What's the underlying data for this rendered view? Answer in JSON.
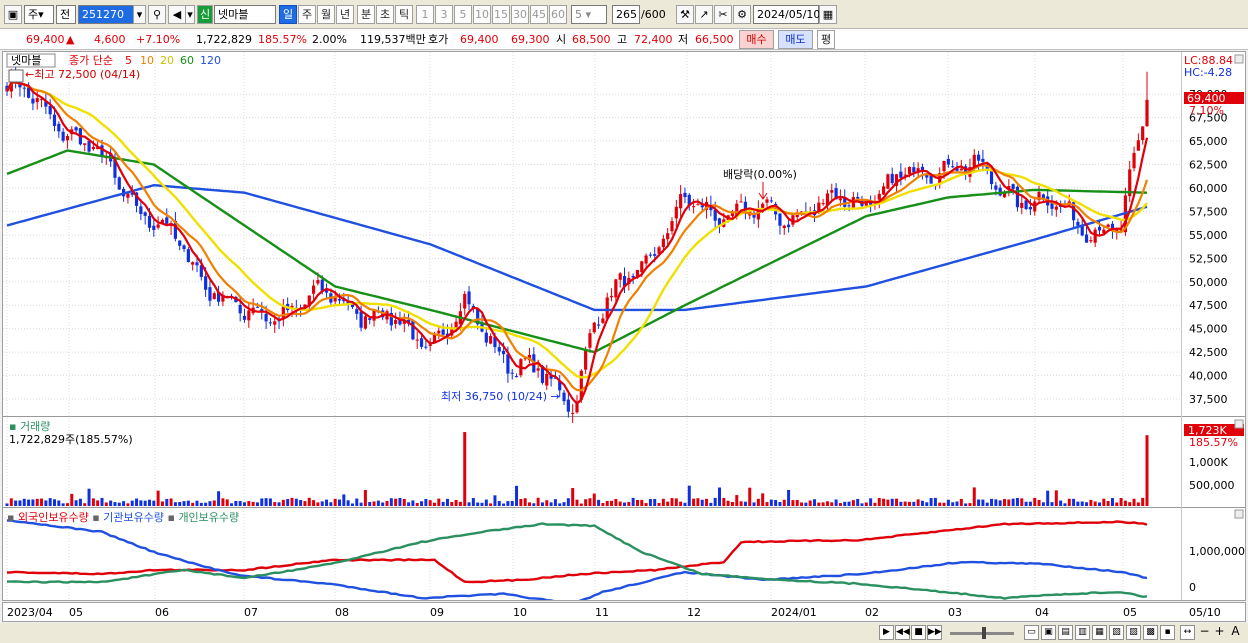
{
  "toolbar": {
    "market": "주",
    "prev": "전",
    "code": "251270",
    "shin": "신",
    "stock_name": "넷마블",
    "periods": [
      "일",
      "주",
      "월",
      "년",
      "분",
      "초",
      "틱"
    ],
    "active_period": "일",
    "nums": [
      "1",
      "3",
      "5",
      "10",
      "15",
      "30",
      "45",
      "60"
    ],
    "interval": "5",
    "count": "265",
    "count_total": "/600",
    "date": "2024/05/10"
  },
  "quote": {
    "price": "69,400",
    "change_arrow": "▲",
    "change": "4,600",
    "change_pct": "+7.10%",
    "volume": "1,722,829",
    "volume_ratio": "185.57%",
    "turnover": "2.00%",
    "amount": "119,537백만",
    "ask_label": "호가",
    "ask": "69,400",
    "bid": "69,300",
    "open_label": "시",
    "open": "68,500",
    "high_label": "고",
    "high": "72,400",
    "low_label": "저",
    "low": "66,500",
    "buy_label": "매수",
    "sell_label": "매도",
    "eval_label": "평"
  },
  "price_panel": {
    "name_tag": "넷마블",
    "ma_label": "종가 단순",
    "ma_periods": [
      "5",
      "10",
      "20",
      "60",
      "120"
    ],
    "max_label": "최고 72,500 (04/14)",
    "min_label": "최저 36,750 (10/24)",
    "dividend_label": "배당락(0.00%)",
    "lc": "LC:88.84",
    "hc": "HC:-4.28",
    "last_price": "69,400",
    "last_pct": "7.10%",
    "yticks": [
      "70,000",
      "67,500",
      "65,000",
      "62,500",
      "60,000",
      "57,500",
      "55,000",
      "52,500",
      "50,000",
      "47,500",
      "45,000",
      "42,500",
      "40,000",
      "37,500"
    ]
  },
  "volume_panel": {
    "title": "거래량",
    "info": "1,722,829주(185.57%)",
    "last": "1,723K",
    "last_pct": "185.57%",
    "yticks": [
      "1,000K",
      "500,000"
    ]
  },
  "holder_panel": {
    "labels": [
      "외국인보유수량",
      "기관보유수량",
      "개인보유수량"
    ],
    "yticks": [
      "1,000,000",
      "0"
    ]
  },
  "xaxis": {
    "labels": [
      "2023/04",
      "05",
      "06",
      "07",
      "08",
      "09",
      "10",
      "11",
      "12",
      "2024/01",
      "02",
      "03",
      "04",
      "05"
    ],
    "right_label": "05/10"
  },
  "colors": {
    "up": "#e0000a",
    "down": "#1030e0",
    "ma5": "#e0000a",
    "ma10": "#f08000",
    "ma20": "#f0e000",
    "ma60": "#189018",
    "ma120": "#2050e0",
    "foreign": "#e0000a",
    "inst": "#2050e0",
    "retail": "#2a9060"
  },
  "chart_data": {
    "type": "line",
    "price_anchors_close": [
      {
        "x": "2023/04",
        "y": 71000
      },
      {
        "x": "05",
        "y": 66500
      },
      {
        "x": "06",
        "y": 56500
      },
      {
        "x": "07",
        "y": 46000
      },
      {
        "x": "08",
        "y": 48500
      },
      {
        "x": "09",
        "y": 43500
      },
      {
        "x": "09-mid",
        "y": 47000
      },
      {
        "x": "10",
        "y": 41500
      },
      {
        "x": "10-24",
        "y": 37500
      },
      {
        "x": "11",
        "y": 45500
      },
      {
        "x": "12",
        "y": 58000
      },
      {
        "x": "2024/01",
        "y": 57000
      },
      {
        "x": "02",
        "y": 59000
      },
      {
        "x": "03",
        "y": 63000
      },
      {
        "x": "04",
        "y": 58500
      },
      {
        "x": "05",
        "y": 55000
      },
      {
        "x": "05/10",
        "y": 69400
      }
    ],
    "ma120_anchors": [
      {
        "x": "2023/04",
        "y": 56000
      },
      {
        "x": "06",
        "y": 60300
      },
      {
        "x": "07",
        "y": 59500
      },
      {
        "x": "09",
        "y": 54000
      },
      {
        "x": "11",
        "y": 47000
      },
      {
        "x": "12",
        "y": 47000
      },
      {
        "x": "2024/02",
        "y": 49500
      },
      {
        "x": "04",
        "y": 54500
      },
      {
        "x": "05/10",
        "y": 58000
      }
    ],
    "ma60_anchors": [
      {
        "x": "2023/04",
        "y": 61500
      },
      {
        "x": "05",
        "y": 64000
      },
      {
        "x": "06",
        "y": 62500
      },
      {
        "x": "07",
        "y": 56000
      },
      {
        "x": "08",
        "y": 49500
      },
      {
        "x": "09",
        "y": 47000
      },
      {
        "x": "11",
        "y": 42500
      },
      {
        "x": "12",
        "y": 47500
      },
      {
        "x": "2024/02",
        "y": 57000
      },
      {
        "x": "03",
        "y": 59000
      },
      {
        "x": "04",
        "y": 59800
      },
      {
        "x": "05/10",
        "y": 59500
      }
    ],
    "ylim": [
      35900,
      74500
    ],
    "volume_spikes": [
      {
        "x": "2023/05",
        "y": 420000
      },
      {
        "x": "09",
        "y": 1800000
      },
      {
        "x": "12",
        "y": 450000
      },
      {
        "x": "05/10",
        "y": 1723000
      }
    ]
  }
}
